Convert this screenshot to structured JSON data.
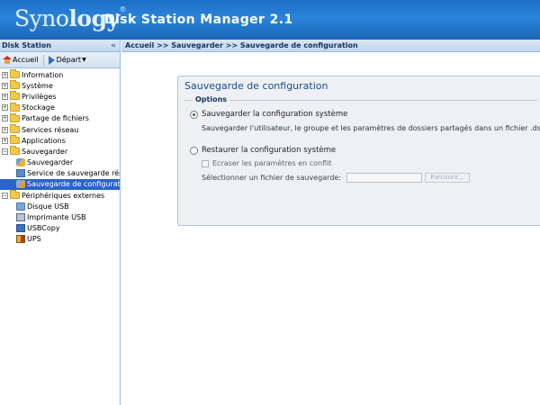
{
  "header": {
    "logo_light": "Syno",
    "logo_bold": "logy",
    "logo_mark": "®",
    "title": "Disk Station Manager 2.1"
  },
  "left_panel": {
    "title": "Disk Station",
    "collapse_glyph": "«",
    "toolbar": {
      "home_label": "Accueil",
      "start_label": "Départ"
    },
    "tree": [
      {
        "label": "Information",
        "expanded": false
      },
      {
        "label": "Système",
        "expanded": false
      },
      {
        "label": "Privilèges",
        "expanded": false
      },
      {
        "label": "Stockage",
        "expanded": false
      },
      {
        "label": "Partage de fichiers",
        "expanded": false
      },
      {
        "label": "Services réseau",
        "expanded": false
      },
      {
        "label": "Applications",
        "expanded": false
      },
      {
        "label": "Sauvegarder",
        "expanded": true,
        "children": [
          "Sauvegarder",
          "Service de sauvegarde rése",
          "Sauvegarde de configuratio"
        ]
      },
      {
        "label": "Périphériques externes",
        "expanded": true,
        "children": [
          "Disque USB",
          "Imprimante USB",
          "USBCopy",
          "UPS"
        ]
      }
    ]
  },
  "breadcrumb": "Accueil >> Sauvegarder >> Sauvegarde de configuration",
  "panel": {
    "title": "Sauvegarde de configuration",
    "options_legend": "Options",
    "option_backup": "Sauvegarder la configuration système",
    "option_backup_desc": "Sauvegarder l'utilisateur, le groupe et les paramètres de dossiers partagés dans un fichier .dss.",
    "option_restore": "Restaurer la configuration système",
    "overwrite_label": "Ecraser les paramètres en conflit",
    "file_label": "Sélectionner un fichier de sauvegarde:",
    "browse_label": "Parcourir..."
  }
}
